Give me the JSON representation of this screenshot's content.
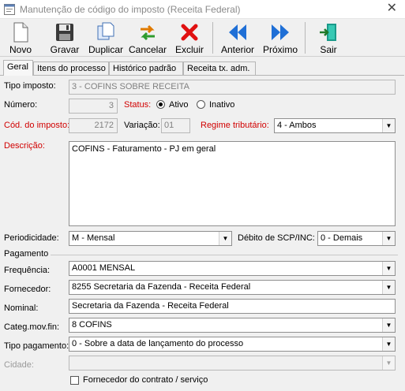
{
  "window": {
    "title": "Manutenção de código do imposto (Receita Federal)",
    "close_glyph": "✕",
    "icon": "app-window-icon"
  },
  "toolbar": {
    "novo": "Novo",
    "gravar": "Gravar",
    "duplicar": "Duplicar",
    "cancelar": "Cancelar",
    "excluir": "Excluir",
    "anterior": "Anterior",
    "proximo": "Próximo",
    "sair": "Sair"
  },
  "tabs": [
    {
      "label": "Geral",
      "active": true
    },
    {
      "label": "Itens do processo",
      "active": false
    },
    {
      "label": "Histórico padrão",
      "active": false
    },
    {
      "label": "Receita tx. adm.",
      "active": false
    }
  ],
  "form": {
    "tipo_imposto": {
      "label": "Tipo imposto:",
      "value": "3 - COFINS SOBRE RECEITA"
    },
    "numero": {
      "label": "Número:",
      "value": "3"
    },
    "status": {
      "label": "Status:",
      "option_ativo": "Ativo",
      "option_inativo": "Inativo",
      "selected": "Ativo"
    },
    "cod_imposto": {
      "label": "Cód. do imposto:",
      "value": "2172"
    },
    "variacao": {
      "label": "Variação:",
      "value": "01"
    },
    "regime": {
      "label": "Regime tributário:",
      "value": "4 - Ambos"
    },
    "descricao": {
      "label": "Descrição:",
      "value": "COFINS - Faturamento - PJ em geral"
    },
    "periodicidade": {
      "label": "Periodicidade:",
      "value": "M - Mensal"
    },
    "debito_scp": {
      "label": "Débito de SCP/INC:",
      "value": "0 - Demais"
    }
  },
  "pagamento": {
    "group_label": "Pagamento",
    "frequencia": {
      "label": "Frequência:",
      "value": "A0001  MENSAL"
    },
    "fornecedor": {
      "label": "Fornecedor:",
      "value": "8255  Secretaria da Fazenda - Receita Federal"
    },
    "nominal": {
      "label": "Nominal:",
      "value": "Secretaria da Fazenda - Receita Federal"
    },
    "categ": {
      "label": "Categ.mov.fin:",
      "value": "8  COFINS"
    },
    "tipo_pagamento": {
      "label": "Tipo pagamento:",
      "value": "0 - Sobre a data de lançamento do processo"
    },
    "cidade": {
      "label": "Cidade:",
      "value": ""
    },
    "fornecedor_contrato": {
      "label": "Fornecedor do contrato / serviço",
      "checked": false
    }
  },
  "colors": {
    "required_label": "#d10000",
    "disabled_text": "#808080",
    "excluir_red": "#e01010",
    "nav_blue": "#1f6fd6"
  }
}
